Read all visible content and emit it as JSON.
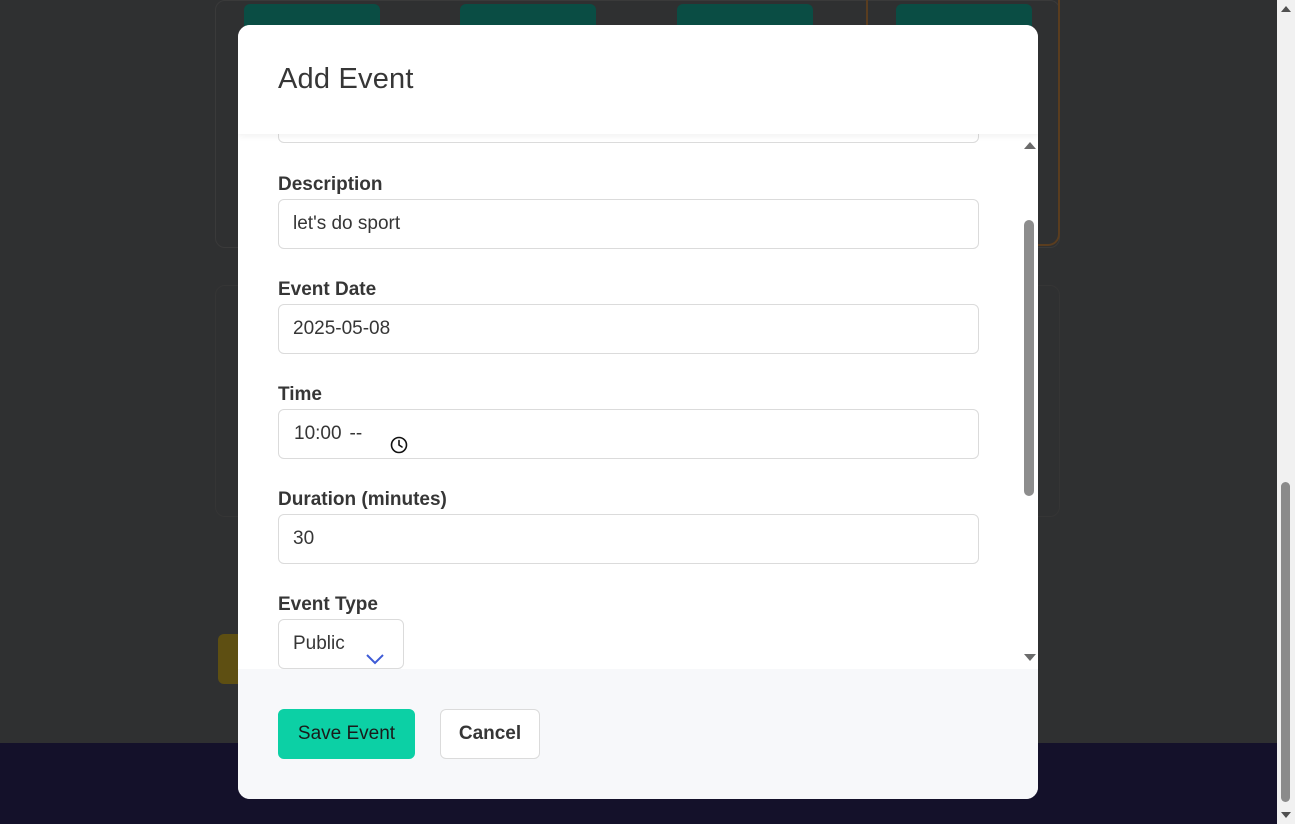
{
  "modal": {
    "title": "Add Event"
  },
  "form": {
    "description": {
      "label": "Description",
      "value": "let's do sport"
    },
    "event_date": {
      "label": "Event Date",
      "value": "2025-05-08"
    },
    "time": {
      "label": "Time",
      "value": "10:00",
      "period": "--",
      "icon": "clock-icon"
    },
    "duration": {
      "label": "Duration (minutes)",
      "value": "30"
    },
    "event_type": {
      "label": "Event Type",
      "selected": "Public",
      "icon": "chevron-down-icon"
    }
  },
  "footer": {
    "save_label": "Save Event",
    "cancel_label": "Cancel"
  },
  "colors": {
    "primary": "#0cd0a5",
    "chevron": "#3e5bd6"
  }
}
